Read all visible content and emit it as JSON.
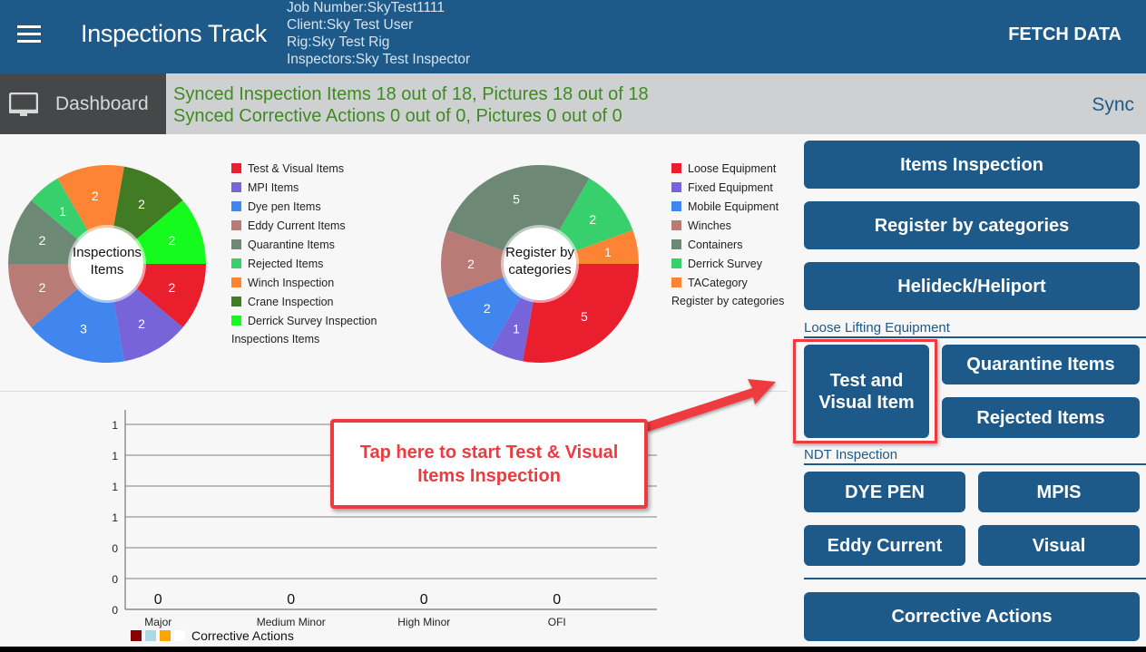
{
  "header": {
    "menu_icon": "hamburger-icon",
    "title": "Inspections Track",
    "job_number": "Job Number:SkyTest1111",
    "client": "Client:Sky Test User",
    "rig": "Rig:Sky Test Rig",
    "inspectors": "Inspectors:Sky Test Inspector",
    "fetch_label": "FETCH DATA"
  },
  "sync": {
    "tab_icon": "monitor-icon",
    "tab_label": "Dashboard",
    "line1": "Synced Inspection Items 18 out of 18, Pictures 18 out of 18",
    "line2": "Synced Corrective Actions 0 out of 0, Pictures 0 out of 0",
    "sync_label": "Sync",
    "status_color": "#3f8b22"
  },
  "chart_data": [
    {
      "type": "pie",
      "title": "Inspections Items",
      "center_label": "Inspections\nItems",
      "legend_title": "Inspections Items",
      "legend_position": "right",
      "start_angle": "3 o'clock, clockwise",
      "slices": [
        {
          "label": "Test & Visual Items",
          "value": 2,
          "color": "#ea1f2e"
        },
        {
          "label": "MPI Items",
          "value": 2,
          "color": "#7664d8"
        },
        {
          "label": "Dye pen Items",
          "value": 3,
          "color": "#4186ee"
        },
        {
          "label": "Eddy Current Items",
          "value": 2,
          "color": "#b97b76"
        },
        {
          "label": "Quarantine Items",
          "value": 2,
          "color": "#6e8876"
        },
        {
          "label": "Rejected Items",
          "value": 1,
          "color": "#38cf6d"
        },
        {
          "label": "Winch Inspection",
          "value": 2,
          "color": "#fd8434"
        },
        {
          "label": "Crane Inspection",
          "value": 2,
          "color": "#417b24"
        },
        {
          "label": "Derrick Survey Inspection",
          "value": 2,
          "color": "#15fb1e"
        }
      ]
    },
    {
      "type": "pie",
      "title": "Register by categories",
      "center_label": "Register by\ncategories",
      "legend_title": "Register by categories",
      "legend_position": "right",
      "start_angle": "3 o'clock, clockwise",
      "slices": [
        {
          "label": "Loose Equipment",
          "value": 5,
          "color": "#ea1f2e"
        },
        {
          "label": "Fixed Equipment",
          "value": 1,
          "color": "#7664d8"
        },
        {
          "label": "Mobile Equipment",
          "value": 2,
          "color": "#4186ee"
        },
        {
          "label": "Winches",
          "value": 2,
          "color": "#b97b76"
        },
        {
          "label": "Containers",
          "value": 5,
          "color": "#6e8876"
        },
        {
          "label": "Derrick Survey",
          "value": 2,
          "color": "#38cf6d"
        },
        {
          "label": "TACategory",
          "value": 1,
          "color": "#fd8434"
        }
      ]
    },
    {
      "type": "bar",
      "title": "",
      "categories": [
        "Major",
        "Medium Minor",
        "High Minor",
        "OFI"
      ],
      "values": [
        0,
        0,
        0,
        0
      ],
      "data_labels": [
        "0",
        "0",
        "0",
        "0"
      ],
      "y_tick_labels": [
        "0",
        "0",
        "0",
        "1",
        "1",
        "1",
        "1"
      ],
      "ylim": [
        0,
        1
      ],
      "grid": true,
      "legend_title": "Corrective Actions",
      "legend_position": "bottom-left",
      "legend_colors": [
        "#8b0000",
        "#add8e6",
        "#ffa500",
        "#ffffff"
      ]
    }
  ],
  "menu": {
    "items_inspection": "Items Inspection",
    "register_by_categories": "Register by categories",
    "helideck": "Helideck/Heliport",
    "loose_section": "Loose Lifting Equipment",
    "test_visual": "Test and\nVisual Item",
    "quarantine": "Quarantine Items",
    "rejected": "Rejected Items",
    "ndt_section": "NDT Inspection",
    "dye_pen": "DYE PEN",
    "mpis": "MPIS",
    "eddy_current": "Eddy Current",
    "visual": "Visual",
    "corrective_actions": "Corrective Actions",
    "button_color": "#1e5a89"
  },
  "annotation": {
    "callout_text": "Tap here to start Test & Visual Items Inspection",
    "color": "#ee3b3f"
  }
}
